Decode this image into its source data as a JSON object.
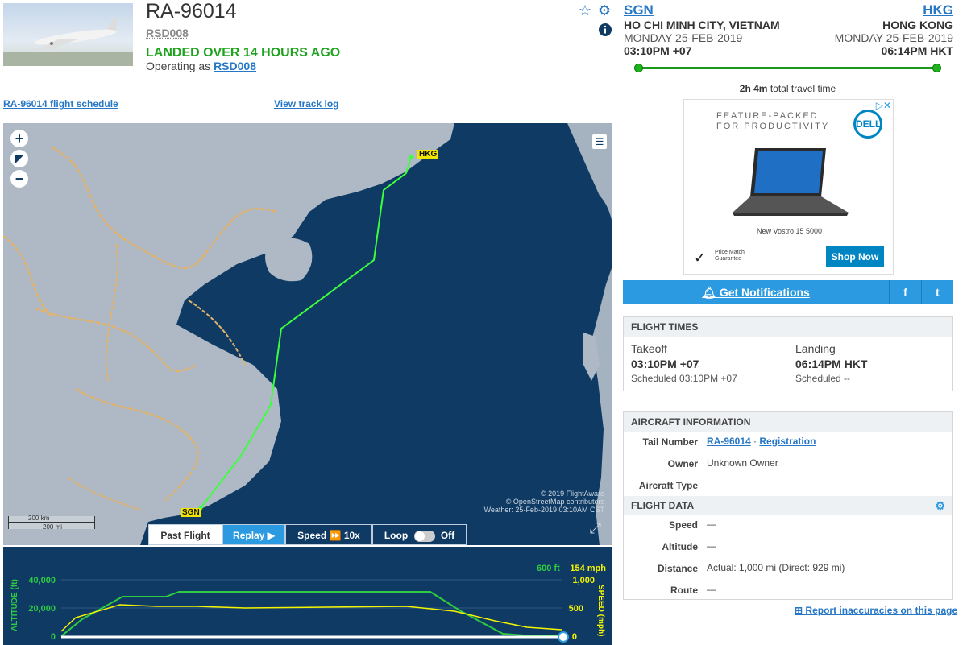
{
  "header": {
    "flight_ident": "RA-96014",
    "callsign": "RSD008",
    "status": "LANDED OVER 14 HOURS AGO",
    "operating_prefix": "Operating as",
    "operating_code": "RSD008"
  },
  "route": {
    "origin": {
      "code": "SGN",
      "city": "HO CHI MINH CITY, VIETNAM",
      "date": "MONDAY 25-FEB-2019",
      "time": "03:10PM +07"
    },
    "destination": {
      "code": "HKG",
      "city": "HONG KONG",
      "date": "MONDAY 25-FEB-2019",
      "time": "06:14PM HKT"
    },
    "travel_duration": "2h 4m",
    "travel_suffix": "total travel time",
    "progress": 1.0
  },
  "links": {
    "schedule": "RA-96014 flight schedule",
    "track_log": "View track log"
  },
  "map": {
    "origin_label": "SGN",
    "dest_label": "HKG",
    "attribution": [
      "© 2019 FlightAware",
      "© OpenStreetMap contributors",
      "Weather: 25-Feb-2019 03:10AM CST"
    ],
    "scale_km": "200 km",
    "scale_mi": "200 mi",
    "controls": {
      "past_flight": "Past Flight",
      "replay": "Replay",
      "speed": "Speed",
      "speed_value": "10x",
      "loop": "Loop",
      "loop_state": "Off"
    }
  },
  "chart": {
    "altitude_axis_label": "ALTITUDE (ft)",
    "speed_axis_label": "SPEED (mph)",
    "altitude_ticks": [
      "40,000",
      "20,000",
      "0"
    ],
    "speed_ticks": [
      "1,000",
      "500",
      "0"
    ],
    "current_altitude": "600 ft",
    "current_speed": "154 mph",
    "altitude_color": "#2ecc40",
    "speed_color": "#f5f500"
  },
  "ad": {
    "headline": [
      "FEATURE-PACKED",
      "FOR PRODUCTIVITY"
    ],
    "brand": "DELL",
    "model": "New Vostro 15 5000",
    "price_match": [
      "Price Match",
      "Guarantee"
    ],
    "cta": "Shop Now"
  },
  "notifications": {
    "label": "Get Notifications",
    "facebook": "f",
    "twitter": "t"
  },
  "flight_times": {
    "title": "FLIGHT TIMES",
    "takeoff_label": "Takeoff",
    "takeoff_time": "03:10PM +07",
    "takeoff_sched": "Scheduled 03:10PM +07",
    "landing_label": "Landing",
    "landing_time": "06:14PM HKT",
    "landing_sched": "Scheduled --"
  },
  "aircraft_info": {
    "title": "AIRCRAFT INFORMATION",
    "tail_label": "Tail Number",
    "tail_value": "RA-96014",
    "tail_sep": "·",
    "registration": "Registration",
    "owner_label": "Owner",
    "owner_value": "Unknown Owner",
    "type_label": "Aircraft Type",
    "type_value": ""
  },
  "flight_data": {
    "title": "FLIGHT DATA",
    "speed_label": "Speed",
    "speed_value": "—",
    "altitude_label": "Altitude",
    "altitude_value": "—",
    "distance_label": "Distance",
    "distance_value": "Actual: 1,000 mi (Direct: 929 mi)",
    "route_label": "Route",
    "route_value": "—"
  },
  "report_link": "Report inaccuracies on this page",
  "colors": {
    "accent": "#2b9ae0",
    "link": "#2677c6",
    "status_green": "#1fa31f",
    "map_sea": "#0e3a64"
  }
}
